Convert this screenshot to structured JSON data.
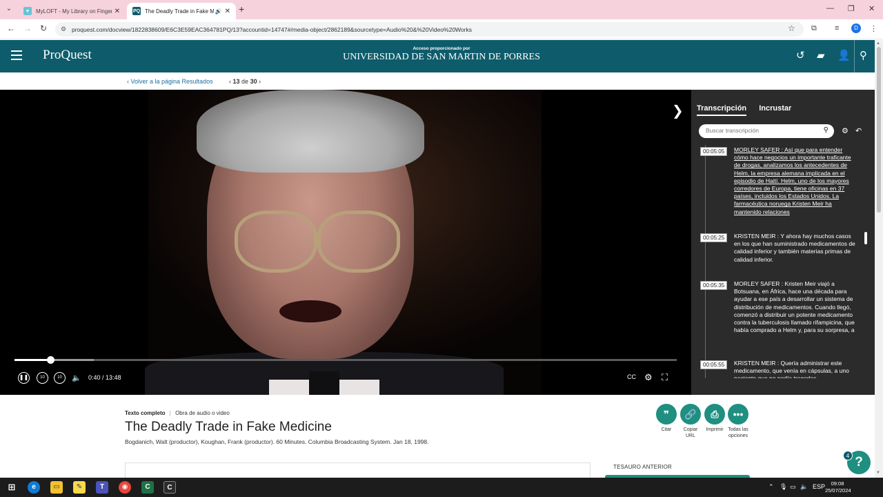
{
  "browser": {
    "tabs": [
      {
        "title": "MyLOFT - My Library on Finger",
        "active": false
      },
      {
        "title": "The Deadly Trade in Fake M",
        "active": true
      }
    ],
    "url": "proquest.com/docview/1822838609/E6C3E59EAC364781PQ/13?accountid=14747#/media-object/2862189&sourcetype=Audio%20&%20Video%20Works"
  },
  "header": {
    "logo": "ProQuest",
    "access_label": "Acceso proporcionado por",
    "institution": "UNIVERSIDAD DE SAN MARTIN DE PORRES"
  },
  "crumb": {
    "back": "‹ Volver a la página Resultados",
    "current": "13",
    "of": "de",
    "total": "30"
  },
  "player": {
    "time": "0:40 / 13:48",
    "played_fraction": 0.054,
    "buffered_fraction": 0.12
  },
  "panel": {
    "tabs": [
      "Transcripción",
      "Incrustar"
    ],
    "search_placeholder": "Buscar transcripción",
    "entries": [
      {
        "time": "00:05:05",
        "text": "MORLEY SAFER : Así que para entender cómo hace negocios un importante traficante de drogas, analizamos los antecedentes de Helm, la empresa alemana implicada en el episodio de Haití. Helm, uno de los mayores corredores de Europa, tiene oficinas en 37 países, incluidos los Estados Unidos. La farmacéutica noruega Kristen Meir ha mantenido relaciones"
      },
      {
        "time": "00:05:25",
        "text": "KRISTEN MEIR : Y ahora hay muchos casos en los que han suministrado medicamentos de calidad inferior y también materias primas de calidad inferior."
      },
      {
        "time": "00:05:35",
        "text": "MORLEY SAFER : Kristen Meir viajó a Botsuana, en África, hace una década para ayudar a ese país a desarrollar un sistema de distribución de medicamentos. Cuando llegó, comenzó a distribuir un potente medicamento contra la tuberculosis llamado rifampicina, que había comprado a Helm y, para su sorpresa, a"
      },
      {
        "time": "00:05:55",
        "text": "KRISTEN MEIR : Quería administrar este medicamento, que venía en cápsulas, a uno paciente que no podía tragarlas"
      }
    ]
  },
  "document": {
    "type_label": "Texto completo",
    "type_sep": "|",
    "type_value": "Obra de audio o video",
    "title": "The Deadly Trade in Fake Medicine",
    "authors": "Bogdanich, Walt (productor), Koughan, Frank (productor). 60 Minutes. Columbia Broadcasting System. Jan 18, 1998.",
    "actions": [
      {
        "icon": "quote-icon",
        "label": "Citar"
      },
      {
        "icon": "link-icon",
        "label": "Copiar URL"
      },
      {
        "icon": "print-icon",
        "label": "Imprimir"
      },
      {
        "icon": "more-icon",
        "label": "Todas las opciones"
      }
    ],
    "tesauro": "TESAURO ANTERIOR",
    "help_badge": "4"
  },
  "taskbar": {
    "language": "ESP",
    "time": "09:08",
    "date": "25/07/2024"
  },
  "colors": {
    "header_bg": "#0e5c6b",
    "accent": "#1e8f80",
    "panel_bg": "#2b2b2b"
  }
}
